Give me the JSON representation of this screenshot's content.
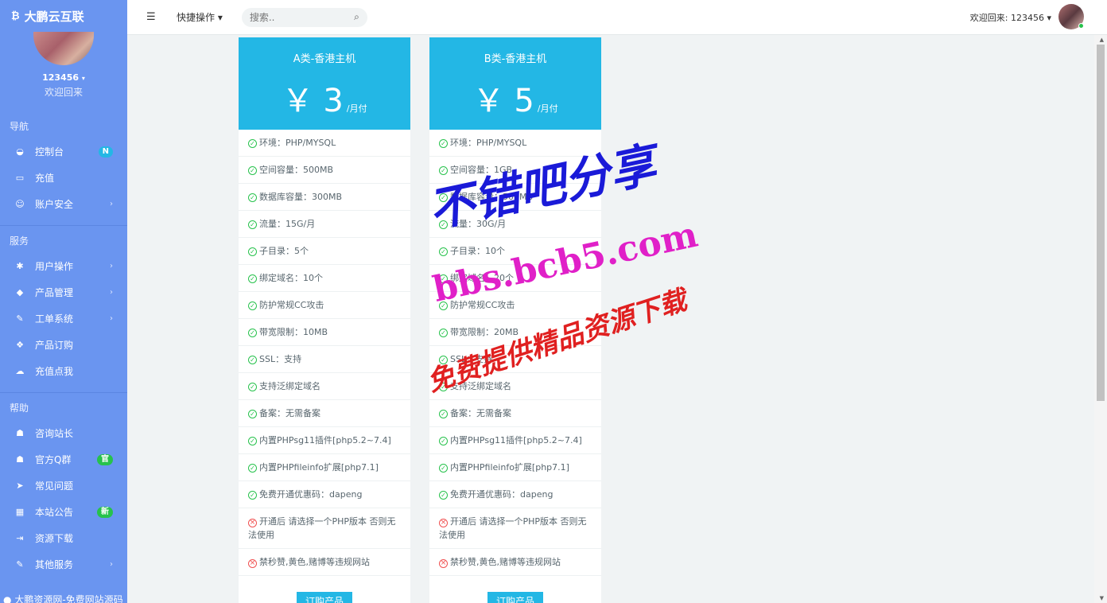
{
  "brand": {
    "icon": "bitcoin-icon",
    "name": "大鹏云互联"
  },
  "profile": {
    "username": "123456",
    "welcome": "欢迎回来"
  },
  "nav": {
    "sections": [
      {
        "header": "导航",
        "items": [
          {
            "label": "控制台",
            "icon": "dashboard-icon",
            "badge": "N",
            "badge_color": "#23b7e5"
          },
          {
            "label": "充值",
            "icon": "card-icon"
          },
          {
            "label": "账户安全",
            "icon": "user-icon",
            "arrow": true
          }
        ]
      },
      {
        "header": "服务",
        "items": [
          {
            "label": "用户操作",
            "icon": "gear-icon",
            "arrow": true
          },
          {
            "label": "产品管理",
            "icon": "diamond-icon",
            "arrow": true
          },
          {
            "label": "工单系统",
            "icon": "edit-icon",
            "arrow": true
          },
          {
            "label": "产品订购",
            "icon": "cube-icon"
          },
          {
            "label": "充值点我",
            "icon": "cloud-download-icon"
          }
        ]
      },
      {
        "header": "帮助",
        "items": [
          {
            "label": "咨询站长",
            "icon": "qq-icon"
          },
          {
            "label": "官方Q群",
            "icon": "qq-icon",
            "badge": "官",
            "badge_color": "#27c24c"
          },
          {
            "label": "常见问题",
            "icon": "paper-plane-icon"
          },
          {
            "label": "本站公告",
            "icon": "calculator-icon",
            "badge": "新",
            "badge_color": "#27c24c"
          },
          {
            "label": "资源下载",
            "icon": "sign-in-icon"
          },
          {
            "label": "其他服务",
            "icon": "edit-icon",
            "arrow": true
          }
        ]
      }
    ],
    "bottom_link": "大鹏资源网-免费网站源码"
  },
  "header": {
    "quick_ops": "快捷操作",
    "search_placeholder": "搜索..",
    "welcome": "欢迎回来: 123456"
  },
  "cards": [
    {
      "title": "A类-香港主机",
      "currency": "￥",
      "price": "3",
      "period": "/月付",
      "features": [
        {
          "ok": true,
          "text": "环境：PHP/MYSQL"
        },
        {
          "ok": true,
          "text": "空间容量：500MB"
        },
        {
          "ok": true,
          "text": "数据库容量：300MB"
        },
        {
          "ok": true,
          "text": "流量：15G/月"
        },
        {
          "ok": true,
          "text": "子目录：5个"
        },
        {
          "ok": true,
          "text": "绑定域名：10个"
        },
        {
          "ok": true,
          "text": "防护常规CC攻击"
        },
        {
          "ok": true,
          "text": "带宽限制：10MB"
        },
        {
          "ok": true,
          "text": "SSL：支持"
        },
        {
          "ok": true,
          "text": "支持泛绑定域名"
        },
        {
          "ok": true,
          "text": "备案：无需备案"
        },
        {
          "ok": true,
          "text": "内置PHPsg11插件[php5.2~7.4]"
        },
        {
          "ok": true,
          "text": "内置PHPfileinfo扩展[php7.1]"
        },
        {
          "ok": true,
          "text": "免费开通优惠码：dapeng"
        },
        {
          "ok": false,
          "text": "开通后 请选择一个PHP版本 否则无法使用"
        },
        {
          "ok": false,
          "text": "禁秒赞,黄色,赌博等违规网站"
        }
      ],
      "button": "订购产品"
    },
    {
      "title": "B类-香港主机",
      "currency": "￥",
      "price": "5",
      "period": "/月付",
      "features": [
        {
          "ok": true,
          "text": "环境：PHP/MYSQL"
        },
        {
          "ok": true,
          "text": "空间容量：1GB"
        },
        {
          "ok": true,
          "text": "数据库容量：500MB"
        },
        {
          "ok": true,
          "text": "流量：30G/月"
        },
        {
          "ok": true,
          "text": "子目录：10个"
        },
        {
          "ok": true,
          "text": "绑定域名：20个"
        },
        {
          "ok": true,
          "text": "防护常规CC攻击"
        },
        {
          "ok": true,
          "text": "带宽限制：20MB"
        },
        {
          "ok": true,
          "text": "SSL：支持"
        },
        {
          "ok": true,
          "text": "支持泛绑定域名"
        },
        {
          "ok": true,
          "text": "备案：无需备案"
        },
        {
          "ok": true,
          "text": "内置PHPsg11插件[php5.2~7.4]"
        },
        {
          "ok": true,
          "text": "内置PHPfileinfo扩展[php7.1]"
        },
        {
          "ok": true,
          "text": "免费开通优惠码：dapeng"
        },
        {
          "ok": false,
          "text": "开通后 请选择一个PHP版本 否则无法使用"
        },
        {
          "ok": false,
          "text": "禁秒赞,黄色,赌博等违规网站"
        }
      ],
      "button": "订购产品"
    }
  ],
  "watermark": {
    "line1": "不错吧分享",
    "line2": "bbs.bcb5.com",
    "line3": "免费提供精品资源下载"
  }
}
